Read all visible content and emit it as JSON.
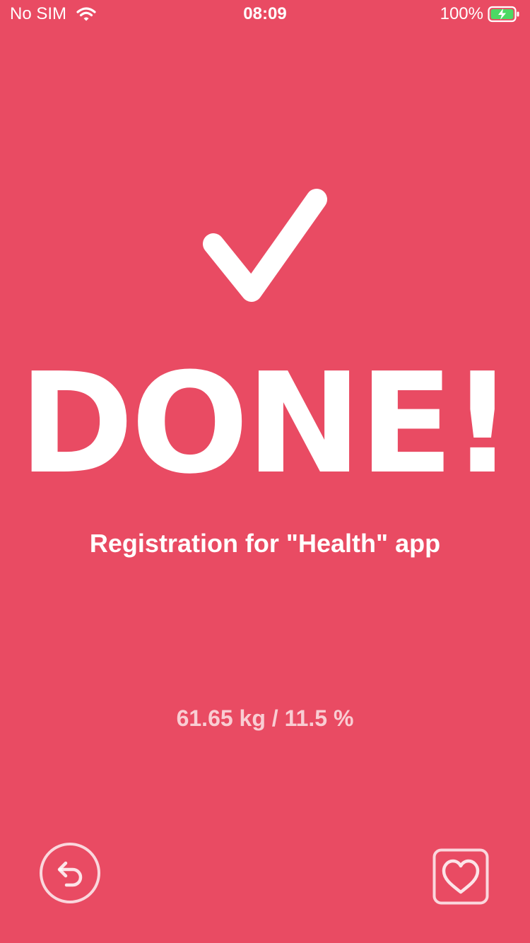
{
  "status_bar": {
    "carrier": "No SIM",
    "time": "08:09",
    "battery_percent": "100%",
    "battery_color": "#4CD964"
  },
  "main": {
    "title": "DONE!",
    "subtitle": "Registration for \"Health\" app",
    "stats": "61.65 kg / 11.5 %"
  },
  "icons": {
    "success": "checkmark-icon",
    "back": "undo-icon",
    "health": "heart-icon"
  },
  "colors": {
    "background": "#E94B63",
    "foreground": "#FFFFFF"
  }
}
